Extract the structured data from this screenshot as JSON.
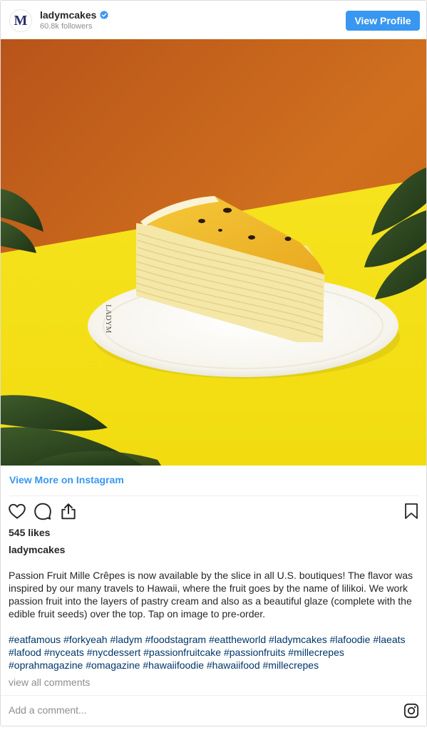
{
  "header": {
    "avatar_letter": "M",
    "username": "ladymcakes",
    "verified": true,
    "followers": "60.8k followers",
    "view_profile_label": "View Profile"
  },
  "photo": {
    "description": "Slice of passion fruit mille crêpe cake on a white plate with LADYM printed on it",
    "plate_text": "LADYM"
  },
  "view_more_label": "View More on Instagram",
  "likes": "545 likes",
  "caption": {
    "username": "ladymcakes",
    "text": "Passion Fruit Mille Crêpes is now available by the slice in all U.S. boutiques! The flavor was inspired by our many travels to Hawaii, where the fruit goes by the name of lilikoi. We work passion fruit into the layers of pastry cream and also as a beautiful glaze (complete with the edible fruit seeds) over the top. Tap on image to pre-order."
  },
  "hashtags": [
    "#eatfamous",
    "#forkyeah",
    "#ladym",
    "#foodstagram",
    "#eattheworld",
    "#ladymcakes",
    "#lafoodie",
    "#laeats",
    "#lafood",
    "#nyceats",
    "#nycdessert",
    "#passionfruitcake",
    "#passionfruits",
    "#millecrepes",
    "#oprahmagazine",
    "#omagazine",
    "#hawaiifoodie",
    "#hawaiifood",
    "#millecrepes"
  ],
  "view_comments_label": "view all comments",
  "comment_placeholder": "Add a comment...",
  "colors": {
    "accent": "#3897f0",
    "hashtag": "#003569",
    "background_orange": "#c8651a",
    "background_yellow": "#f5e11a"
  },
  "icons": [
    "heart-icon",
    "comment-icon",
    "share-icon",
    "bookmark-icon",
    "instagram-icon",
    "verified-icon"
  ]
}
